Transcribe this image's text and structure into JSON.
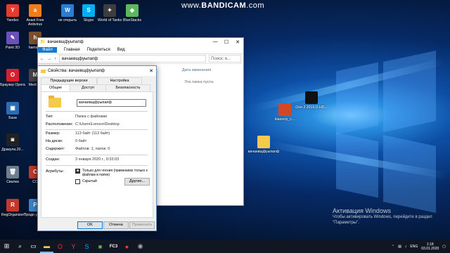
{
  "watermark": {
    "prefix": "www.",
    "brand": "BANDICAM",
    "suffix": ".com"
  },
  "desktop_icons": [
    {
      "label": "Yandex",
      "color": "#e63b2e",
      "glyph": "Y"
    },
    {
      "label": "Avast Free Antivirus",
      "color": "#f07c1a",
      "glyph": "a"
    },
    {
      "label": "не открыть",
      "color": "#2b7cd3",
      "glyph": "W"
    },
    {
      "label": "Skype",
      "color": "#00aff0",
      "glyph": "S"
    },
    {
      "label": "World of Tanks",
      "color": "#3d3d3d",
      "glyph": "✦"
    },
    {
      "label": "BlueStacks",
      "color": "#5cb85c",
      "glyph": "◆"
    },
    {
      "label": "hamster",
      "color": "#7a4f2a",
      "glyph": "h"
    },
    {
      "label": "Paint 3D",
      "color": "#6b4fbb",
      "glyph": "✎"
    },
    {
      "label": "Браузер Opera",
      "color": "#d6202e",
      "glyph": "O"
    },
    {
      "label": "Medi Cli",
      "color": "#444",
      "glyph": "M"
    },
    {
      "label": "База",
      "color": "#2a6db5",
      "glyph": "▣"
    },
    {
      "label": "Дракула.20...",
      "color": "#222",
      "glyph": "◙"
    },
    {
      "label": "Свалка",
      "color": "#6f7e8c",
      "glyph": "🗑"
    },
    {
      "label": "CC",
      "color": "#c0392b",
      "glyph": "C"
    },
    {
      "label": "RegOrganizer",
      "color": "#c0392b",
      "glyph": "R"
    },
    {
      "label": "Продо устано",
      "color": "#3b82c4",
      "glyph": "P"
    }
  ],
  "right_icons": [
    {
      "label": "Оно 2 2019.D.HD...",
      "color": "#111"
    },
    {
      "label": "klassniy_c...",
      "color": "#d24726"
    },
    {
      "label": "вачаевщфуыпапф",
      "color": "#f5c94c"
    }
  ],
  "explorer": {
    "title": "вачаевщфуыпапф",
    "tabs": [
      "Файл",
      "Главная",
      "Поделиться",
      "Вид"
    ],
    "path": "вачаевщфуыпапф",
    "search_placeholder": "Поиск: в...",
    "col_header": "Дата изменения",
    "empty_text": "Эта папка пуста."
  },
  "props": {
    "title": "Свойства: вачаевщфуыпапф",
    "tabs_row1": [
      "Предыдущие версии",
      "Настройка"
    ],
    "tabs_row2": [
      "Общие",
      "Доступ",
      "Безопасность"
    ],
    "name": "вачаевщфуыпапф",
    "type_label": "Тип:",
    "type_value": "Папка с файлами",
    "location_label": "Расположение:",
    "location_value": "C:\\Users\\Lenovo\\Desktop",
    "size_label": "Размер:",
    "size_value": "113 байт (113 байт)",
    "ondisk_label": "На диске:",
    "ondisk_value": "0 байт",
    "contains_label": "Содержит:",
    "contains_value": "Файлов: 1; папок: 0",
    "created_label": "Создан:",
    "created_value": "3 января 2020 г., 0:33:03",
    "attrs_label": "Атрибуты:",
    "readonly_label": "Только для чтения (применимо только к файлам в папке)",
    "hidden_label": "Скрытый",
    "other_btn": "Другие...",
    "ok": "OK",
    "cancel": "Отмена",
    "apply": "Применить"
  },
  "activation": {
    "title": "Активация Windows",
    "text": "Чтобы активировать Windows, перейдите в раздел \"Параметры\"."
  },
  "taskbar": {
    "icons": [
      "start",
      "search",
      "task-view",
      "explorer",
      "opera",
      "yandex",
      "skype",
      "minecraft",
      "fc3",
      "yandex-browser",
      "media"
    ],
    "lang": "ENG",
    "time": "1:18",
    "date": "03.01.2020"
  }
}
